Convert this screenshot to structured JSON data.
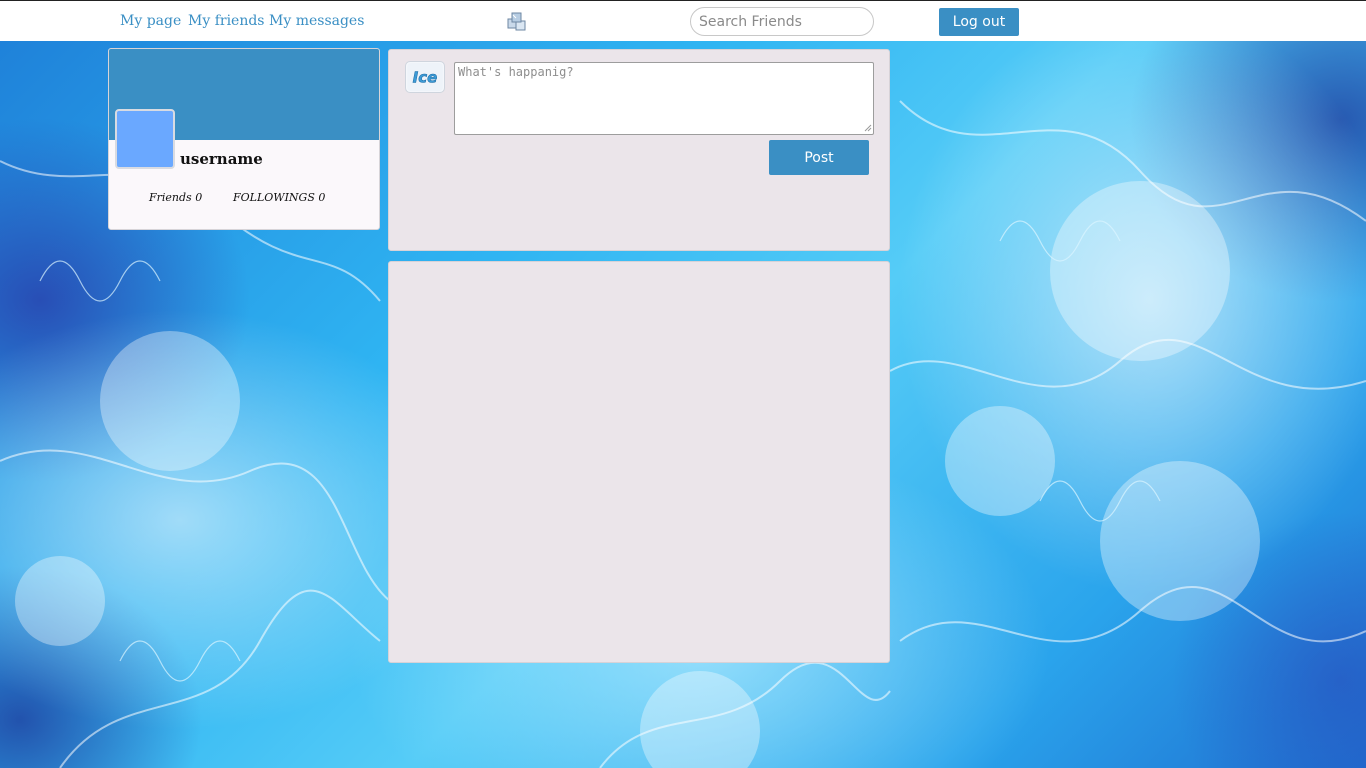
{
  "nav": {
    "links": [
      {
        "label": "My page"
      },
      {
        "label": "My friends"
      },
      {
        "label": "My messages"
      }
    ],
    "logo_icon": "ice-cubes-icon",
    "search": {
      "placeholder": "Search Friends",
      "value": ""
    },
    "logout_label": "Log out"
  },
  "profile": {
    "username": "username",
    "friends_label": "Friends",
    "friends_count": "0",
    "followings_label": "FOLLOWINGS",
    "followings_count": "0"
  },
  "composer": {
    "icon": "ice-logo-icon",
    "icon_text": "Ice",
    "placeholder": "What's happanig?",
    "value": "",
    "post_label": "Post"
  },
  "feed": {
    "items": []
  },
  "colors": {
    "accent": "#3a8fc4",
    "panel": "#ebe5ea",
    "card": "#fbf8fb",
    "avatar": "#6aa8ff"
  }
}
